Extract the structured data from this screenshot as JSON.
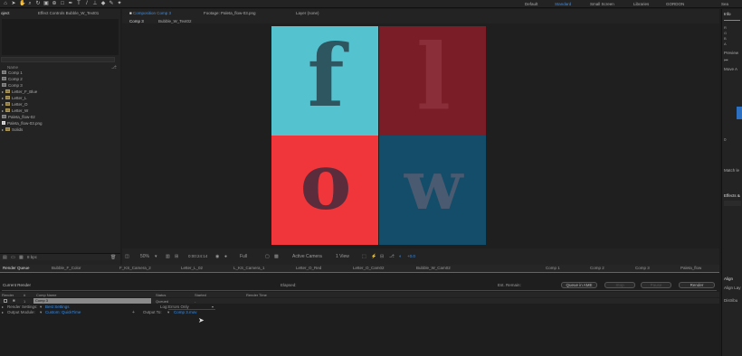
{
  "toolbar": {
    "workspaces": [
      "Default",
      "Standard",
      "Small Screen",
      "Libraries",
      "GORDON"
    ],
    "active_workspace": "Standard"
  },
  "project": {
    "tab_project": "oject",
    "tab_effect": "Effect Controls Bubble_W_Text01",
    "header": "Name",
    "items": [
      "Comp 1",
      "Comp 2",
      "Comp 3",
      "Letter_F_Blue",
      "Letter_L",
      "Letter_O",
      "Letter_W",
      "Paleta_flow-02",
      "Paleta_flow-03.png",
      "Solids"
    ],
    "bpc": "8 bpc"
  },
  "viewer": {
    "tab_composition": "Composition Comp 3",
    "tab_footage": "Footage: Paleta_flow-03.png",
    "tab_layer": "Layer (none)",
    "subtab1": "Comp 3",
    "subtab2": "Bubble_W_Text02",
    "zoom": "50%",
    "timecode": "0:00:24:14",
    "resolution": "Full",
    "camera": "Active Camera",
    "views": "1 View",
    "offset": "+0.0",
    "letters": [
      "f",
      "l",
      "o",
      "w"
    ]
  },
  "right_panel": {
    "info": "Info",
    "preview": "Preview",
    "move": "Move A",
    "effects": "Effects &",
    "match": "Match le",
    "align": "Align",
    "align_layers": "Align Lay",
    "distribute": "Distribu",
    "search_label": "Sea",
    "value": "0"
  },
  "render_queue": {
    "tabs": [
      "Render Queue",
      "Bubble_F_Color",
      "F_KS_Camera_2",
      "Letter_L_02",
      "L_KS_Camera_1",
      "Letter_O_Red",
      "Letter_O_Cam02",
      "Bubble_W_Cam02",
      "Comp 1",
      "Comp 2",
      "Comp 3",
      "Paleta_flow"
    ],
    "current_render": "Current Render",
    "elapsed": "Elapsed:",
    "est_remain": "Est. Remain:",
    "queue_ame": "Queue in AME",
    "stop": "Stop",
    "pause": "Pause",
    "render": "Render",
    "columns": [
      "Render",
      "#",
      "Comp Name",
      "Status",
      "Started",
      "Render Time"
    ],
    "row": {
      "num": "1",
      "comp": "Comp 3",
      "status": "Queued",
      "started": "-",
      "time": ""
    },
    "render_settings_label": "Render Settings:",
    "render_settings_value": "Best Settings",
    "output_module_label": "Output Module:",
    "output_module_value": "Custom: QuickTime",
    "log_label": "Log:",
    "log_value": "Errors Only",
    "output_to_label": "Output To:",
    "output_to_value": "Comp 3.mov"
  },
  "colors": {
    "tile_cyan": "#55c3cf",
    "tile_maroon": "#7a1d27",
    "tile_red": "#f0363a",
    "tile_teal": "#134d69",
    "accent": "#3a8ee8"
  }
}
